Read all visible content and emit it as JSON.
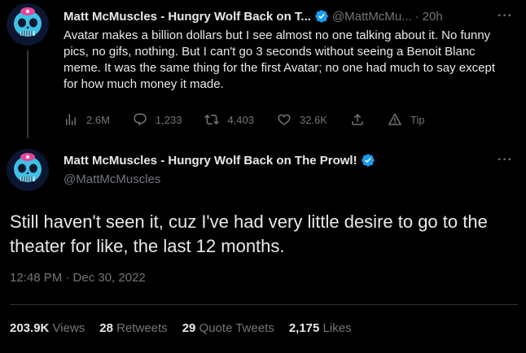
{
  "tweet1": {
    "name": "Matt McMuscles - Hungry Wolf Back on T...",
    "handle": "@MattMcMu...",
    "separator": "·",
    "time": "20h",
    "more": "···",
    "text": "Avatar makes a billion dollars but I see almost no one talking about it. No funny pics, no gifs, nothing. But I can't go 3 seconds without seeing a Benoit Blanc meme. It was the same thing for the first Avatar; no one had much to say except for how much money it made.",
    "actions": {
      "views": "2.6M",
      "replies": "1,233",
      "retweets": "4,403",
      "likes": "32.6K",
      "tip": "Tip"
    }
  },
  "tweet2": {
    "name": "Matt McMuscles - Hungry Wolf Back on The Prowl!",
    "handle": "@MattMcMuscles",
    "more": "···",
    "text": "Still haven't seen it, cuz I've had very little desire to go to the theater for like, the last 12 months.",
    "timestamp": "12:48 PM · Dec 30, 2022",
    "stats": {
      "views_count": "203.9K",
      "views_label": "Views",
      "retweets_count": "28",
      "retweets_label": "Retweets",
      "quotes_count": "29",
      "quotes_label": "Quote Tweets",
      "likes_count": "2,175",
      "likes_label": "Likes"
    }
  },
  "colors": {
    "background": "#000000",
    "text": "#e7e9ea",
    "secondary": "#71767b",
    "verified": "#1d9bf0",
    "avatar_skull": "#3fc1e6",
    "avatar_accent": "#e4469c"
  },
  "icons": [
    "avatar",
    "verified-badge-icon",
    "views-chart-icon",
    "reply-icon",
    "retweet-icon",
    "like-icon",
    "share-icon",
    "tip-icon",
    "more-icon"
  ]
}
